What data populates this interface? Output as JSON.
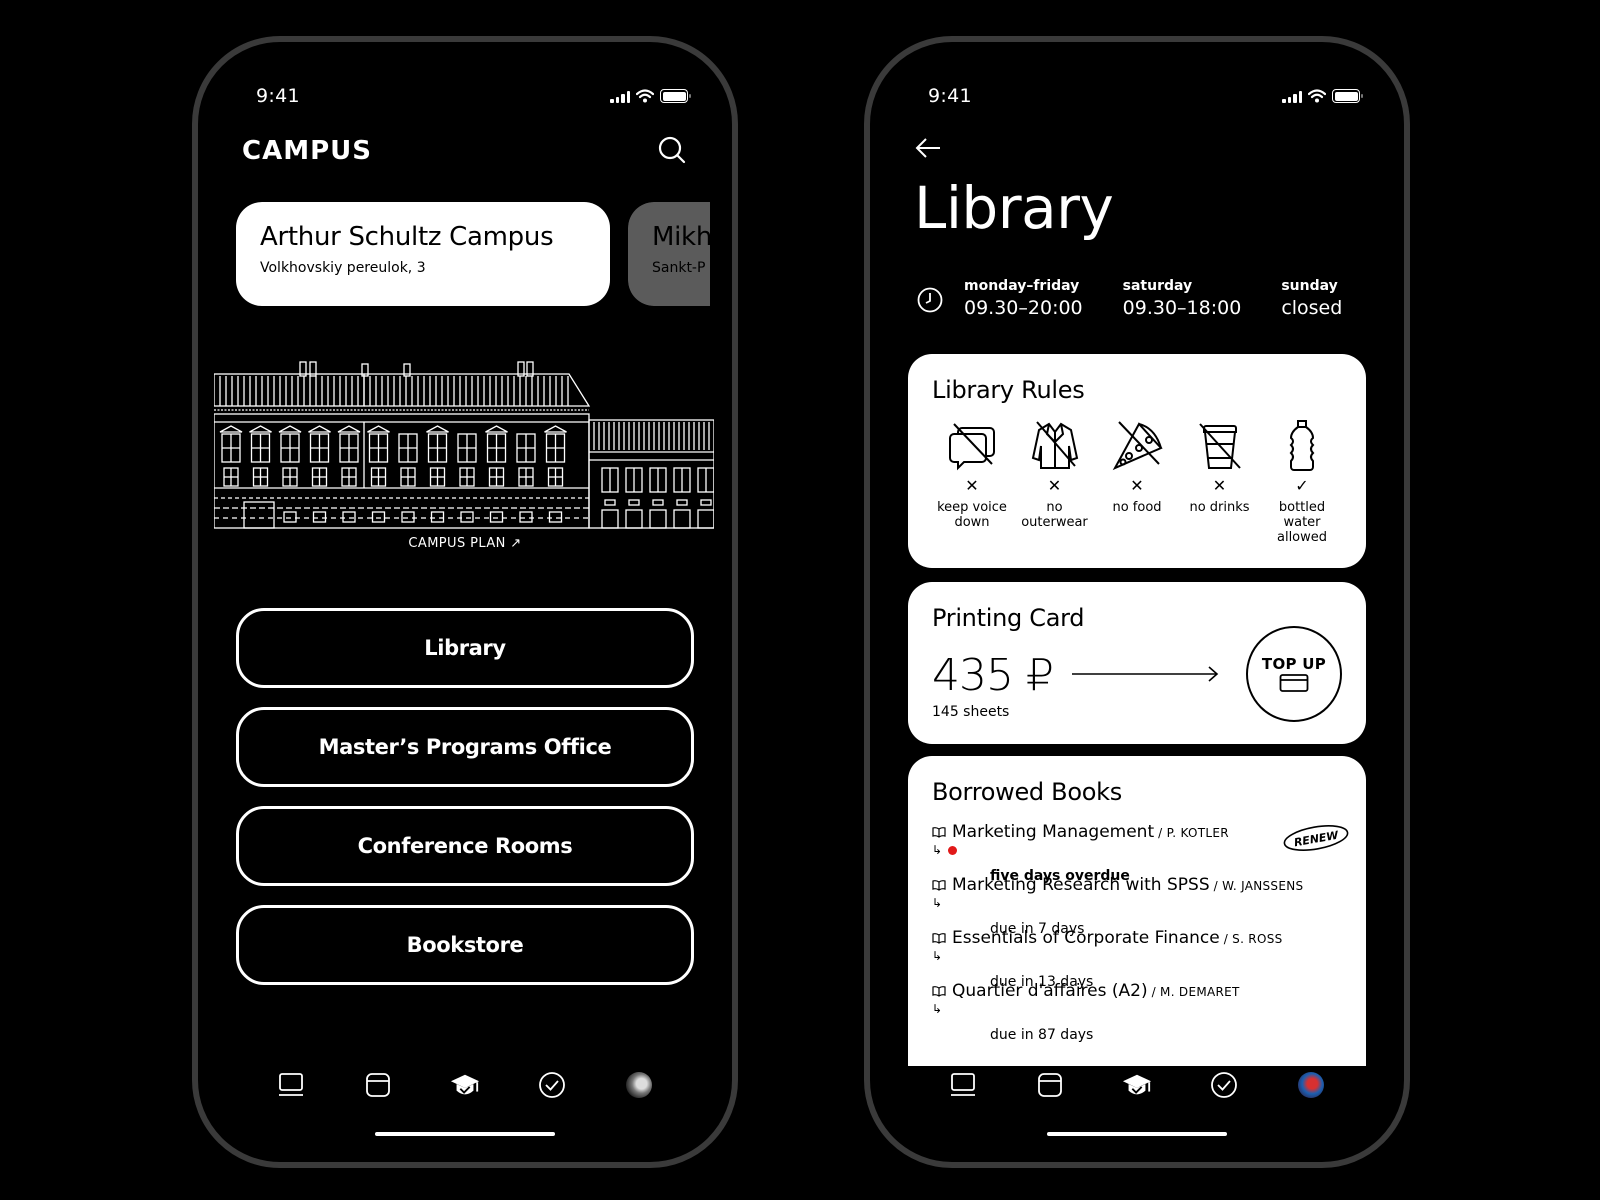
{
  "status_bar": {
    "time": "9:41"
  },
  "left_screen": {
    "brand": "CAMPUS",
    "search_icon": "search-icon",
    "campuses": [
      {
        "name": "Arthur Schultz Campus",
        "address": "Volkhovskiy pereulok, 3"
      },
      {
        "name": "Mikh",
        "address": "Sankt-P"
      }
    ],
    "campus_plan_label": "CAMPUS PLAN ↗",
    "menu": [
      {
        "label": "Library"
      },
      {
        "label": "Master’s Programs Office"
      },
      {
        "label": "Conference Rooms"
      },
      {
        "label": "Bookstore"
      }
    ]
  },
  "right_screen": {
    "back_icon": "arrow-left-icon",
    "title": "Library",
    "hours": [
      {
        "day": "monday–friday",
        "time": "09.30–20:00"
      },
      {
        "day": "saturday",
        "time": "09.30–18:00"
      },
      {
        "day": "sunday",
        "time": "closed"
      }
    ],
    "rules": {
      "title": "Library Rules",
      "items": [
        {
          "icon": "no-talking-icon",
          "mark": "✕",
          "label": "keep voice\ndown"
        },
        {
          "icon": "no-outerwear-icon",
          "mark": "✕",
          "label": "no\nouterwear"
        },
        {
          "icon": "no-food-icon",
          "mark": "✕",
          "label": "no food"
        },
        {
          "icon": "no-drinks-icon",
          "mark": "✕",
          "label": "no drinks"
        },
        {
          "icon": "water-bottle-icon",
          "mark": "✓",
          "label": "bottled\nwater allowed"
        }
      ]
    },
    "printing": {
      "title": "Printing Card",
      "amount": "435 ₽",
      "sheets": "145 sheets",
      "top_up_label": "TOP UP"
    },
    "borrowed": {
      "title": "Borrowed Books",
      "renew_label": "RENEW",
      "books": [
        {
          "title": "Marketing Management",
          "author": "/ P. KOTLER",
          "status": "five days overdue",
          "overdue": true
        },
        {
          "title": "Marketing Research with SPSS",
          "author": "/ W. JANSSENS",
          "status": "due in 7 days",
          "overdue": false
        },
        {
          "title": "Essentials of Corporate Finance",
          "author": "/ S. ROSS",
          "status": "due in 13 days",
          "overdue": false
        },
        {
          "title": "Quartier d'affaires (A2)",
          "author": "/ M. DEMARET",
          "status": "due in 87 days",
          "overdue": false
        }
      ]
    }
  },
  "tabbar": [
    {
      "name": "laptop-icon"
    },
    {
      "name": "calendar-icon"
    },
    {
      "name": "graduation-cap-icon",
      "active": true
    },
    {
      "name": "check-circle-icon"
    },
    {
      "name": "avatar"
    }
  ],
  "colors": {
    "background": "#000000",
    "frame": "#3a3a3a",
    "card": "#ffffff",
    "inactive_card": "#5b5b5b",
    "overdue_dot": "#e11919"
  }
}
